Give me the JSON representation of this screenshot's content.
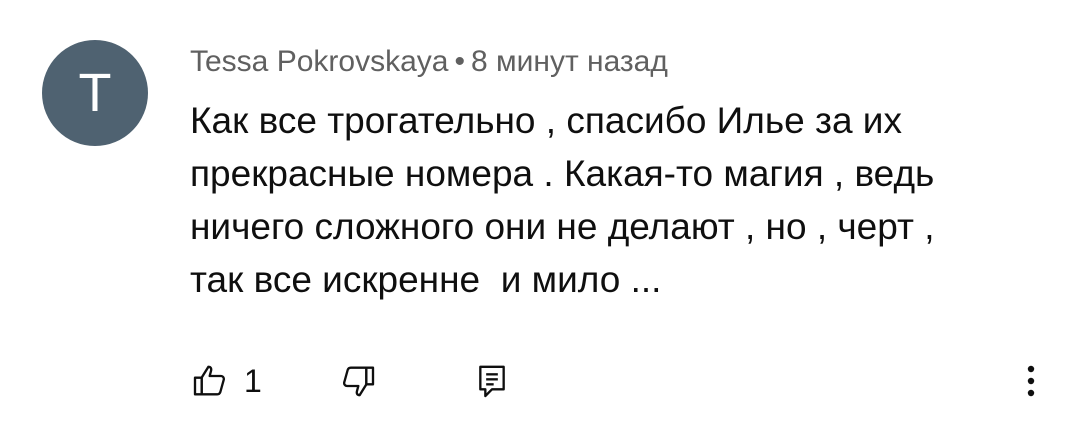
{
  "comment": {
    "avatar_letter": "T",
    "avatar_color": "#4f6271",
    "author": "Tessa Pokrovskaya",
    "separator": "•",
    "time": "8 минут назад",
    "text": "Как все трогательно , спасибо Илье за их\nпрекрасные номера . Какая-то магия , ведь\nничего сложного они не делают , но , черт ,\nтак все искренне  и мило ..."
  },
  "actions": {
    "like_icon": "thumbs-up-icon",
    "like_count": "1",
    "dislike_icon": "thumbs-down-icon",
    "reply_icon": "reply-comment-icon",
    "more_icon": "more-vertical-icon"
  }
}
